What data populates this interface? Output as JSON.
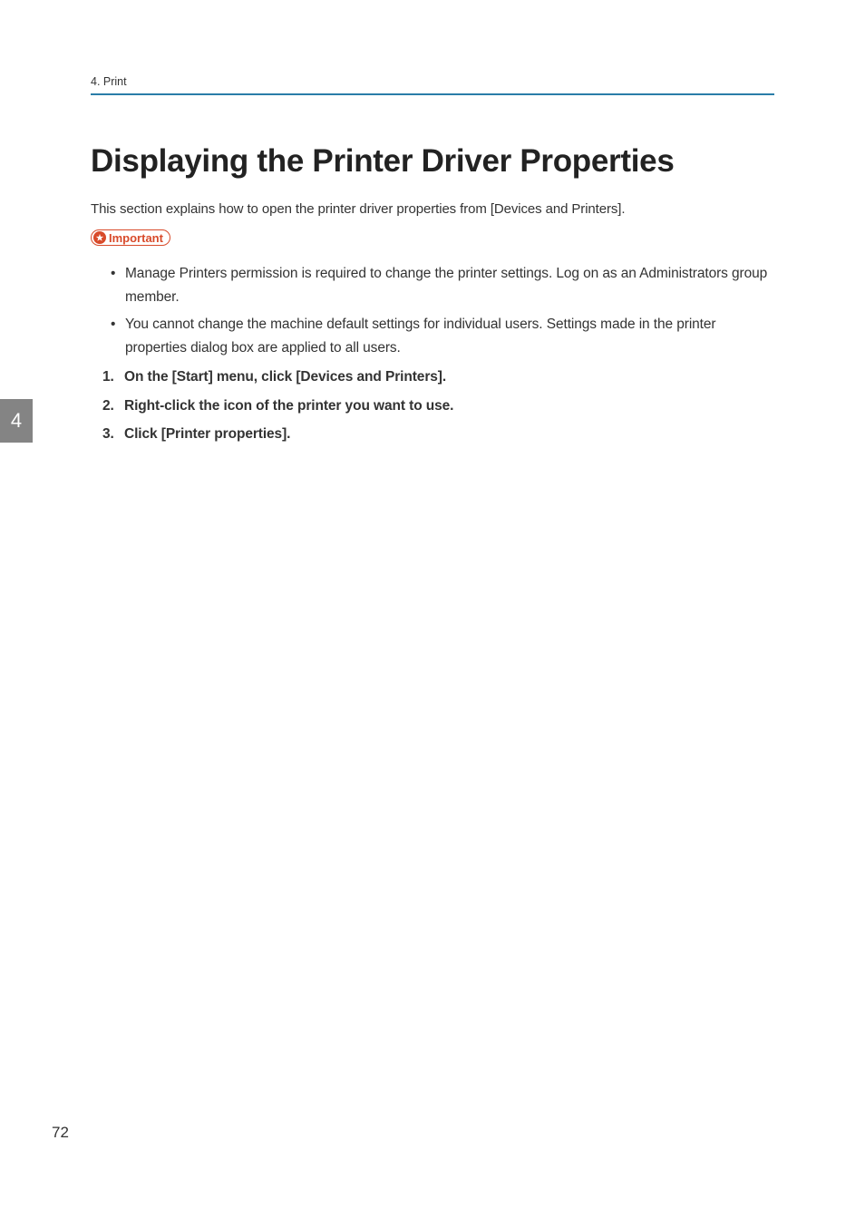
{
  "header": {
    "chapter_label": "4. Print"
  },
  "title": "Displaying the Printer Driver Properties",
  "intro": "This section explains how to open the printer driver properties from [Devices and Printers].",
  "important": {
    "label": "Important"
  },
  "bullets": [
    "Manage Printers permission is required to change the printer settings. Log on as an Administrators group member.",
    "You cannot change the machine default settings for individual users. Settings made in the printer properties dialog box are applied to all users."
  ],
  "steps": [
    {
      "number": "1.",
      "text": "On the [Start] menu, click [Devices and Printers]."
    },
    {
      "number": "2.",
      "text": "Right-click the icon of the printer you want to use."
    },
    {
      "number": "3.",
      "text": "Click [Printer properties]."
    }
  ],
  "chapter_tab": "4",
  "page_number": "72"
}
